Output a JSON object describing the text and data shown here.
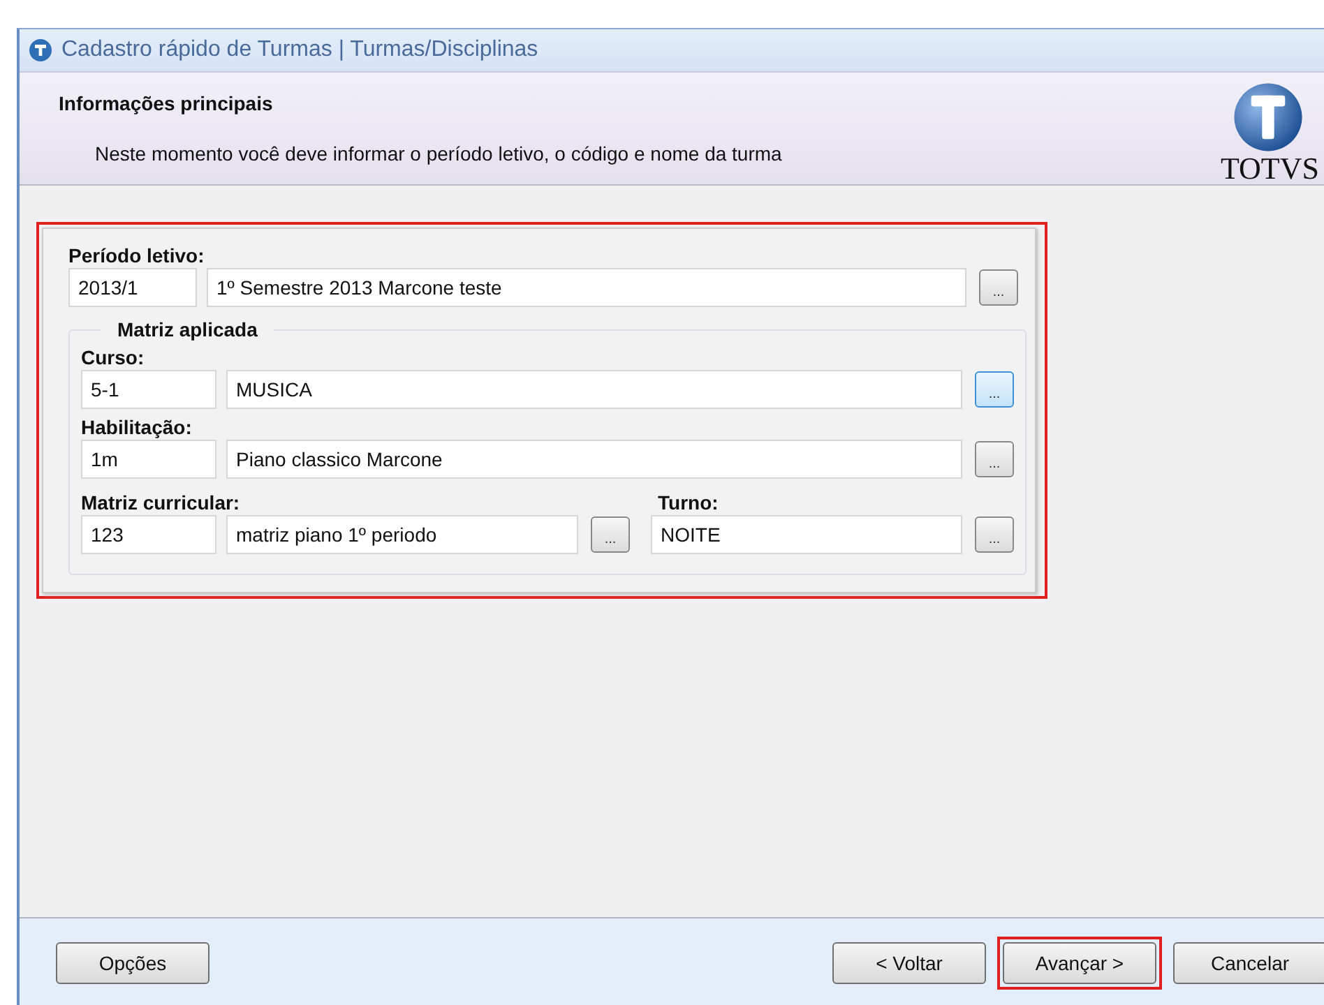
{
  "window": {
    "title": "Cadastro rápido de Turmas | Turmas/Disciplinas"
  },
  "header": {
    "title": "Informações principais",
    "description": "Neste momento você deve informar o período letivo, o código e nome da turma",
    "logo_text": "TOTVS"
  },
  "form": {
    "highlighted": true,
    "periodo": {
      "label": "Período letivo:",
      "code": "2013/1",
      "name": "1º Semestre 2013 Marcone teste",
      "browse": "...",
      "focused": false
    },
    "group": {
      "title": "Matriz aplicada",
      "rows": [
        {
          "label": "Curso:",
          "code": "5-1",
          "name": "MUSICA",
          "browse": "...",
          "focused": true
        },
        {
          "label": "Habilitação:",
          "code": "1m",
          "name": "Piano classico Marcone",
          "browse": "...",
          "focused": false
        }
      ],
      "matriz": {
        "label": "Matriz curricular:",
        "code": "123",
        "name": "matriz piano 1º periodo",
        "browse": "...",
        "focused": false
      },
      "turno": {
        "label": "Turno:",
        "value": "NOITE",
        "browse": "...",
        "focused": false
      }
    }
  },
  "footer": {
    "left_button": {
      "label": "Opções",
      "highlighted": false
    },
    "buttons": [
      {
        "label": "< Voltar",
        "highlighted": false
      },
      {
        "label": "Avançar >",
        "highlighted": true
      },
      {
        "label": "Cancelar",
        "highlighted": false
      }
    ]
  }
}
